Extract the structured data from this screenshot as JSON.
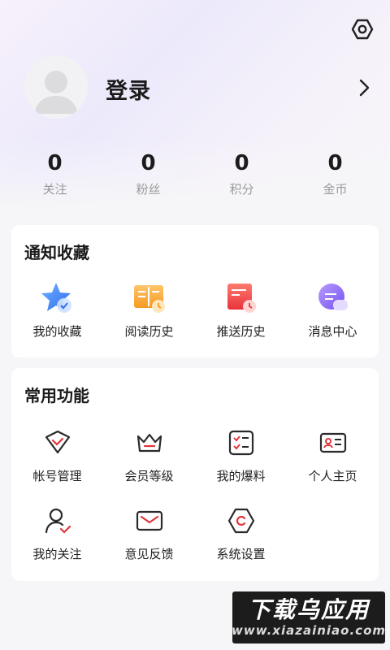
{
  "header": {
    "settings_icon": "hexagon-settings-icon",
    "login_label": "登录",
    "chevron_icon": "chevron-right-icon"
  },
  "stats": [
    {
      "value": "0",
      "label": "关注"
    },
    {
      "value": "0",
      "label": "粉丝"
    },
    {
      "value": "0",
      "label": "积分"
    },
    {
      "value": "0",
      "label": "金币"
    }
  ],
  "notify_section": {
    "title": "通知收藏",
    "items": [
      {
        "label": "我的收藏",
        "icon": "star-collection-icon"
      },
      {
        "label": "阅读历史",
        "icon": "book-history-icon"
      },
      {
        "label": "推送历史",
        "icon": "push-history-icon"
      },
      {
        "label": "消息中心",
        "icon": "message-bubble-icon"
      }
    ]
  },
  "common_section": {
    "title": "常用功能",
    "items": [
      {
        "label": "帐号管理",
        "icon": "account-shield-icon"
      },
      {
        "label": "会员等级",
        "icon": "crown-icon"
      },
      {
        "label": "我的爆料",
        "icon": "checklist-icon"
      },
      {
        "label": "个人主页",
        "icon": "id-card-icon"
      },
      {
        "label": "我的关注",
        "icon": "user-check-icon"
      },
      {
        "label": "意见反馈",
        "icon": "mail-icon"
      },
      {
        "label": "系统设置",
        "icon": "settings-hexagon-icon"
      }
    ]
  },
  "watermark": {
    "title": "下载乌应用",
    "url": "www.xiazainiao.com"
  },
  "colors": {
    "accent_red": "#e0363c",
    "dark_icon": "#2a2a2a"
  }
}
